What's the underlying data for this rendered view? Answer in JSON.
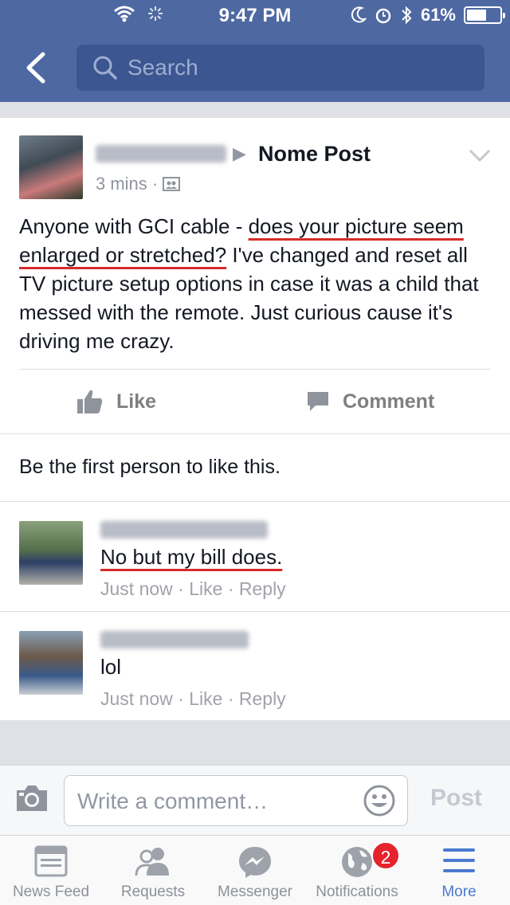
{
  "status_bar": {
    "time": "9:47 PM",
    "battery": "61%",
    "battery_level": 0.61
  },
  "header": {
    "search_placeholder": "Search"
  },
  "post": {
    "target": "Nome Post",
    "time": "3 mins",
    "text_before": "Anyone with GCI cable - ",
    "text_highlight": "does your picture seem enlarged or stretched?",
    "text_after": " I've changed and reset all TV picture setup options in case it was a child that messed with the remote. Just curious cause it's driving me crazy.",
    "like_label": "Like",
    "comment_label": "Comment",
    "likes_text": "Be the first person to like this."
  },
  "comments": [
    {
      "text": "No but my bill does.",
      "time": "Just now",
      "like": "Like",
      "reply": "Reply"
    },
    {
      "text": "lol",
      "time": "Just now",
      "like": "Like",
      "reply": "Reply"
    }
  ],
  "composer": {
    "placeholder": "Write a comment…",
    "post_label": "Post"
  },
  "tabs": [
    {
      "label": "News Feed",
      "icon": "news-feed-icon"
    },
    {
      "label": "Requests",
      "icon": "requests-icon"
    },
    {
      "label": "Messenger",
      "icon": "messenger-icon"
    },
    {
      "label": "Notifications",
      "icon": "notifications-icon",
      "badge": "2"
    },
    {
      "label": "More",
      "icon": "more-icon",
      "active": true
    }
  ],
  "colors": {
    "header": "#4e69a2",
    "badge": "#e4232d",
    "active_tab": "#4a7ad0",
    "underline": "#d62b2b"
  }
}
